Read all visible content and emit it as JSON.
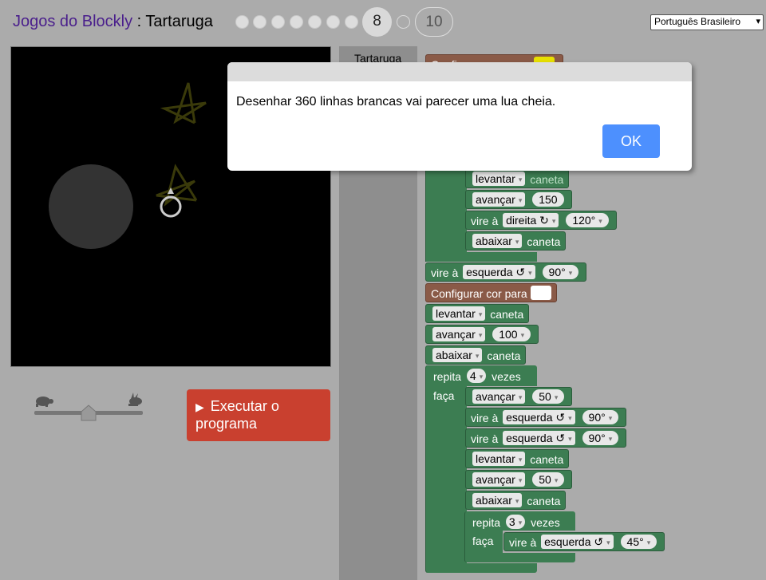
{
  "header": {
    "app_link": "Jogos do Blockly",
    "separator": " : ",
    "game_name": "Tartaruga",
    "current_level": "8",
    "next_level": "10",
    "language": "Português Brasileiro"
  },
  "colors": {
    "background": "#ababab",
    "run_button": "#c9402f",
    "ok_button": "#4d90fe",
    "turtle_block": "#3c7d52",
    "colour_block": "#8a5a47",
    "star_stroke": "#3a3a0a",
    "moon": "#333333"
  },
  "controls": {
    "run_label": "Executar o programa",
    "run_icon": "play-triangle-icon",
    "slow_icon": "turtle-icon",
    "fast_icon": "rabbit-icon",
    "speed": 0.5
  },
  "toolbox": {
    "category": "Tartaruga"
  },
  "dialog": {
    "message": "Desenhar 360 linhas brancas vai parecer uma lua cheia.",
    "ok_label": "OK"
  },
  "blocks": {
    "set_colour": "Configurar cor para",
    "pen_up": "levantar",
    "pen_down": "abaixar",
    "pen_word": "caneta",
    "move": "avançar",
    "turn": "vire à",
    "right": "direita ↻",
    "left": "esquerda ↺",
    "repeat": "repita",
    "times": "vezes",
    "do": "faça",
    "v150": "150",
    "v120": "120°",
    "v90": "90°",
    "v100": "100",
    "v4": "4",
    "v50": "50",
    "v3": "3",
    "v45": "45°"
  }
}
